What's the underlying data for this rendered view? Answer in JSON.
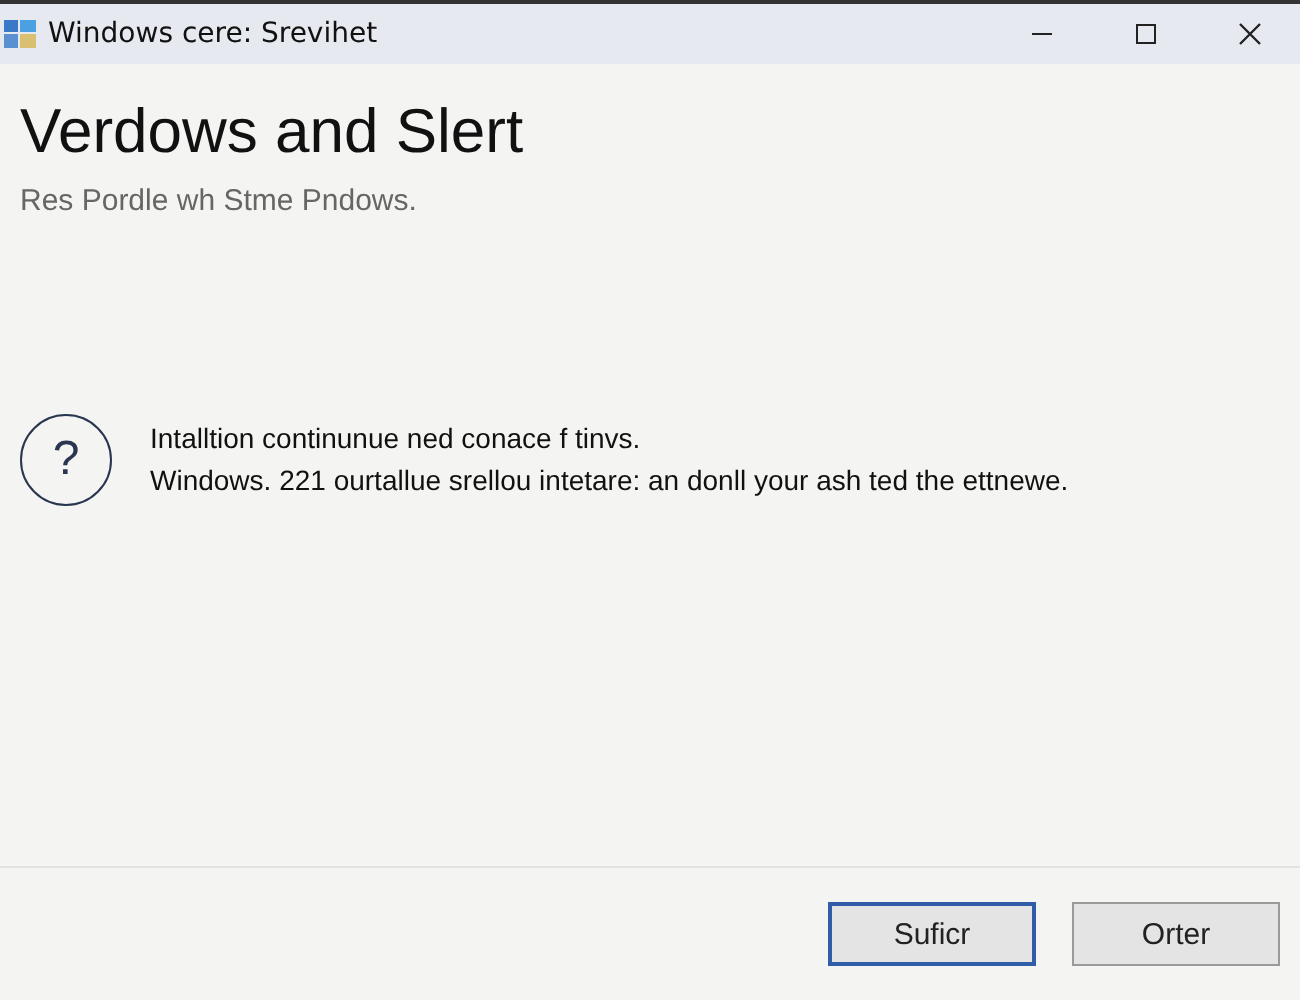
{
  "window": {
    "title": "Windows cere: Srevihet"
  },
  "heading": "Verdows and Slert",
  "subtitle": "Res Pordle wh Stme Pndows.",
  "message": {
    "icon": "?",
    "lines": [
      "Intalltion continunue ned conace f tinvs.",
      "Windows. 221 ourtallue srellou intetare: an donll your ash ted the ettnewe."
    ]
  },
  "buttons": [
    {
      "label": "Suficr",
      "default": true
    },
    {
      "label": "Orter",
      "default": false
    }
  ]
}
